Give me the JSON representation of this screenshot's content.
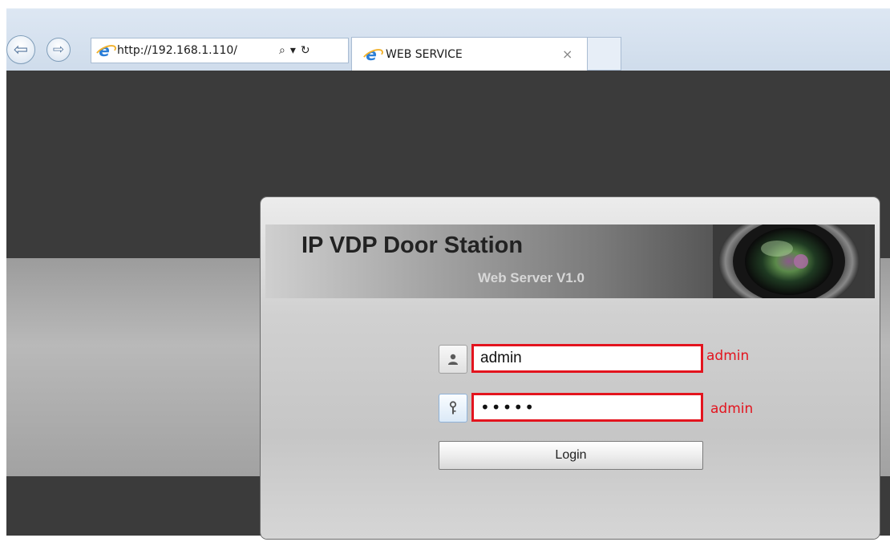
{
  "browser": {
    "url": "http://192.168.1.110/",
    "tab_title": "WEB SERVICE",
    "tab_close": "×",
    "back_icon": "back-arrow-icon",
    "forward_icon": "forward-arrow-icon",
    "search_glyph": "⌕",
    "dropdown_glyph": "▾",
    "refresh_glyph": "↻"
  },
  "login": {
    "title": "IP VDP Door Station",
    "subtitle": "Web Server V1.0",
    "username_value": "admin",
    "password_value": "•••••",
    "button_label": "Login",
    "username_hint": "admin",
    "password_hint": "admin"
  },
  "colors": {
    "highlight": "#e3141e",
    "page_background": "#3b3b3b"
  }
}
